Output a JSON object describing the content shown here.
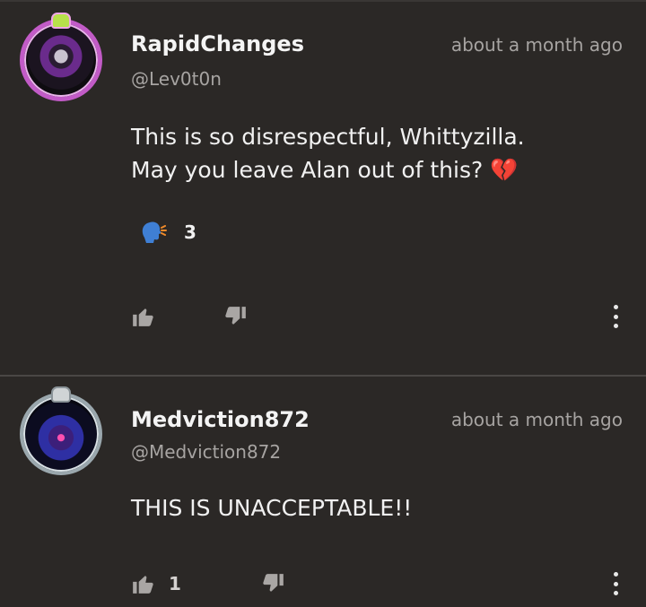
{
  "comments": [
    {
      "user": "RapidChanges",
      "handle": "@Lev0t0n",
      "time": "about a month ago",
      "text_line1": "This is so disrespectful, Whittyzilla.",
      "text_line2": "May you leave Alan out of this? ",
      "emoji": "💔",
      "reaction_count": "3",
      "like_count": ""
    },
    {
      "user": "Medviction872",
      "handle": "@Medviction872",
      "time": "about a month ago",
      "text": "THIS IS UNACCEPTABLE!!",
      "like_count": "1"
    }
  ],
  "colors": {
    "background": "#2b2826",
    "divider": "#4a4745",
    "muted_text": "#a7a4a2",
    "reaction_blue": "#3f7fd4"
  },
  "icons": [
    "speaking-head-icon",
    "thumb-up-icon",
    "thumb-down-icon",
    "more-vertical-icon"
  ]
}
